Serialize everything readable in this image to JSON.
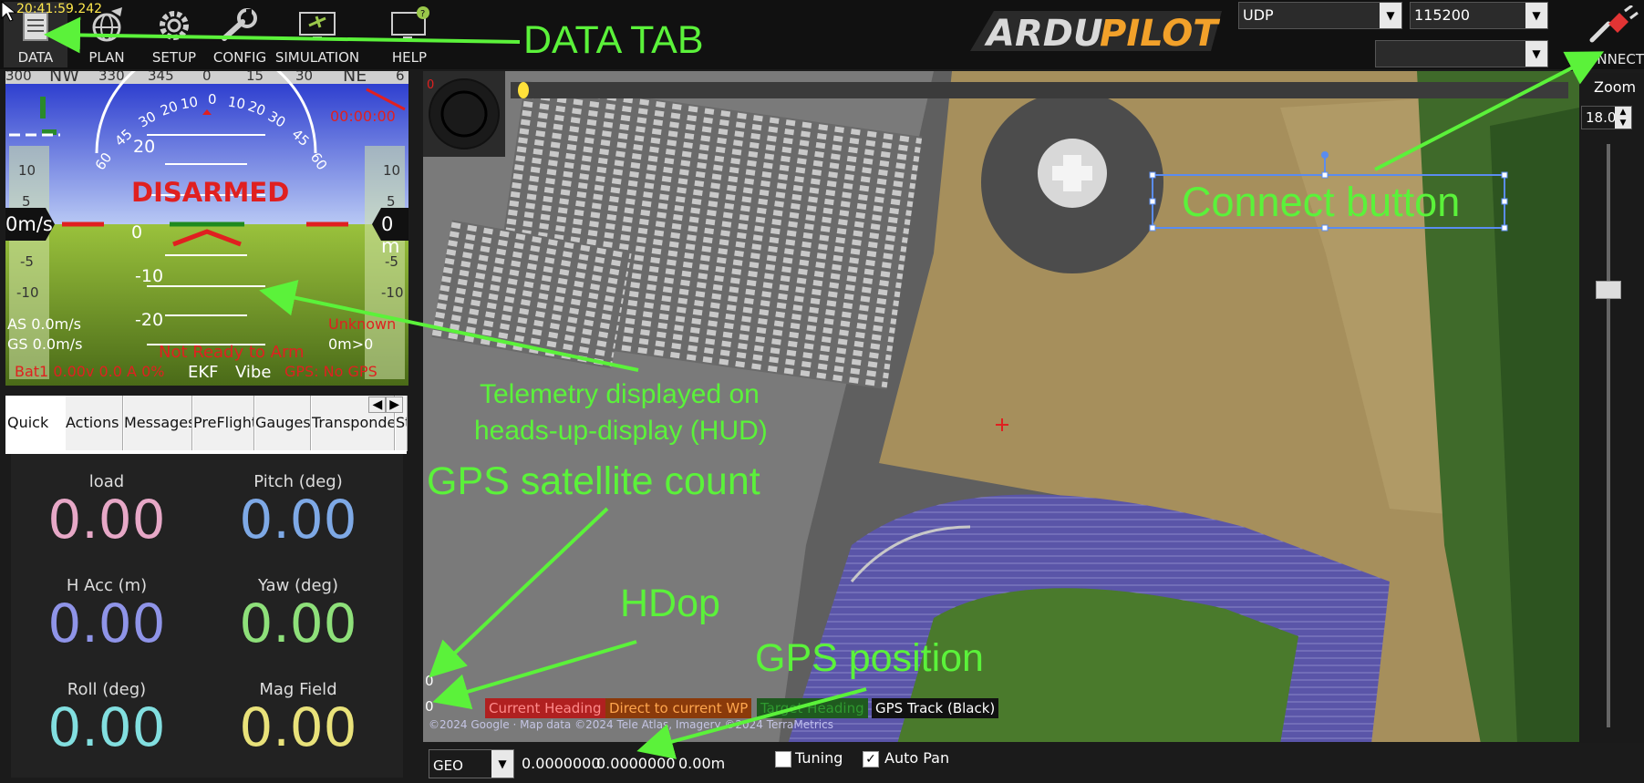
{
  "clock": "20:41:59.242",
  "menu": [
    {
      "label": "DATA",
      "icon": "data-icon"
    },
    {
      "label": "PLAN",
      "icon": "globe-icon"
    },
    {
      "label": "SETUP",
      "icon": "gear-icon"
    },
    {
      "label": "CONFIG",
      "icon": "wrench-icon"
    },
    {
      "label": "SIMULATION",
      "icon": "monitor-plane-icon"
    },
    {
      "label": "HELP",
      "icon": "monitor-help-icon"
    }
  ],
  "logo_text": "ARDUPILOT",
  "connection": {
    "port": "UDP",
    "baud": "115200",
    "link": "",
    "connect_label": "CONNECT"
  },
  "hud": {
    "status": "DISARMED",
    "speed_left": "0m/s",
    "speed_right": "0 m",
    "time": "00:00:00",
    "heading_labels": [
      "300",
      "NW",
      "330",
      "345",
      "0",
      "15",
      "30",
      "NE",
      "6"
    ],
    "roll_labels": [
      "60",
      "45",
      "30",
      "20",
      "10",
      "0",
      "10",
      "20",
      "30",
      "45",
      "60"
    ],
    "pitch_labels": [
      "20",
      "10",
      "0",
      "-10",
      "-20"
    ],
    "left_scale": [
      "10",
      "5",
      "-5",
      "-10"
    ],
    "right_scale": [
      "10",
      "5",
      "-5",
      "-10"
    ],
    "airspeed": "AS 0.0m/s",
    "groundspeed": "GS 0.0m/s",
    "arm_status": "Not Ready to Arm",
    "mode": "Unknown",
    "dist": "0m>0",
    "battery": "Bat1 0.00v 0.0 A 0%",
    "ekf": "EKF",
    "vibe": "Vibe",
    "gps": "GPS: No GPS"
  },
  "tabs": [
    "Quick",
    "Actions",
    "Messages",
    "PreFlight",
    "Gauges",
    "Transponder",
    "St"
  ],
  "quick": [
    {
      "label": "load",
      "value": "0.00",
      "color": "#e7a8c7"
    },
    {
      "label": "Pitch (deg)",
      "value": "0.00",
      "color": "#7ea9e6"
    },
    {
      "label": "H Acc (m)",
      "value": "0.00",
      "color": "#8f94e8"
    },
    {
      "label": "Yaw (deg)",
      "value": "0.00",
      "color": "#8ee07a"
    },
    {
      "label": "Roll (deg)",
      "value": "0.00",
      "color": "#82dfe0"
    },
    {
      "label": "Mag Field",
      "value": "0.00",
      "color": "#e9e27a"
    }
  ],
  "map": {
    "sat_count": "0",
    "hdop": "0",
    "wp_counter": "0",
    "legend": [
      {
        "label": "Current Heading",
        "color": "#ff2b2b"
      },
      {
        "label": "Direct to current WP",
        "color": "#ff8a1a"
      },
      {
        "label": "Target Heading",
        "color": "#2f9a2f"
      },
      {
        "label": "GPS Track (Black)",
        "color": "#ffffff"
      }
    ],
    "copyright": "©2024 Google · Map data ©2024 Tele Atlas, Imagery ©2024 TerraMetrics"
  },
  "bottom": {
    "coord_type": "GEO",
    "lat": "0.0000000",
    "lon": "0.0000000",
    "alt": "0.00m",
    "tuning_label": "Tuning",
    "autopan_label": "Auto Pan",
    "tuning_checked": false,
    "autopan_checked": true
  },
  "zoom": {
    "label": "Zoom",
    "value": "18.0"
  },
  "annotations": {
    "data_tab": "DATA TAB",
    "connect_button": "Connect button",
    "telemetry_line1": "Telemetry displayed on",
    "telemetry_line2": "heads-up-display (HUD)",
    "gps_sat": "GPS satellite count",
    "hdop": "HDop",
    "gps_pos": "GPS position"
  }
}
